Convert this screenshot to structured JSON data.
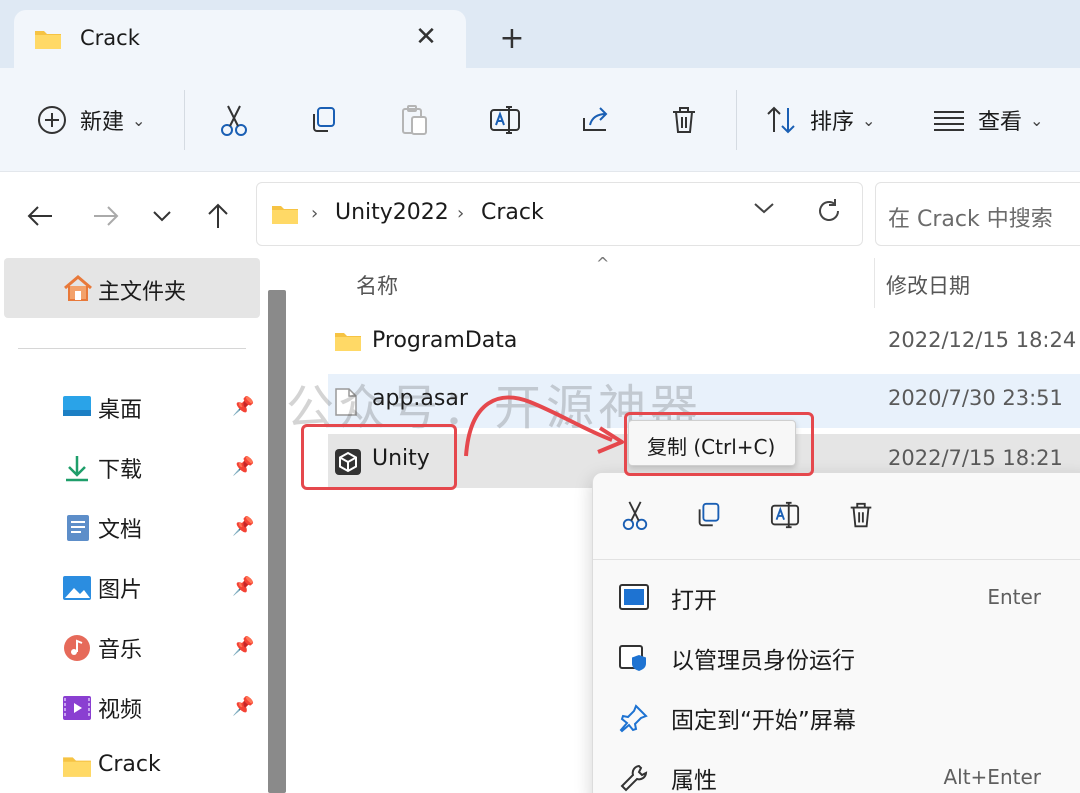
{
  "window": {
    "tab_title": "Crack",
    "new_tab": "+",
    "close": "✕"
  },
  "toolbar": {
    "new_label": "新建",
    "sort_label": "排序",
    "view_label": "查看"
  },
  "address": {
    "crumbs": [
      "Unity2022",
      "Crack"
    ],
    "search_placeholder": "在 Crack 中搜索"
  },
  "sidebar": {
    "home": "主文件夹",
    "items": [
      {
        "label": "桌面",
        "icon": "desktop-icon"
      },
      {
        "label": "下载",
        "icon": "download-icon"
      },
      {
        "label": "文档",
        "icon": "document-icon"
      },
      {
        "label": "图片",
        "icon": "pictures-icon"
      },
      {
        "label": "音乐",
        "icon": "music-icon"
      },
      {
        "label": "视频",
        "icon": "video-icon"
      },
      {
        "label": "Crack",
        "icon": "folder-icon"
      }
    ]
  },
  "columns": {
    "name": "名称",
    "date": "修改日期"
  },
  "files": [
    {
      "name": "ProgramData",
      "date": "2022/12/15 18:24",
      "icon": "folder-icon"
    },
    {
      "name": "app.asar",
      "date": "2020/7/30 23:51",
      "icon": "file-icon"
    },
    {
      "name": "Unity",
      "date": "2022/7/15 18:21",
      "icon": "unity-icon"
    }
  ],
  "tooltip": "复制 (Ctrl+C)",
  "context_menu": {
    "items": [
      {
        "label": "打开",
        "key": "Enter"
      },
      {
        "label": "以管理员身份运行",
        "key": ""
      },
      {
        "label": "固定到“开始”屏幕",
        "key": ""
      },
      {
        "label": "属性",
        "key": "Alt+Enter"
      }
    ]
  },
  "watermark": "公众号：开源神器",
  "colors": {
    "accent": "#0067c0",
    "annotation": "#e5484d",
    "folder": "#f6c343",
    "selected_row": "#e5e5e5",
    "hover_row": "#e8f1fb"
  }
}
